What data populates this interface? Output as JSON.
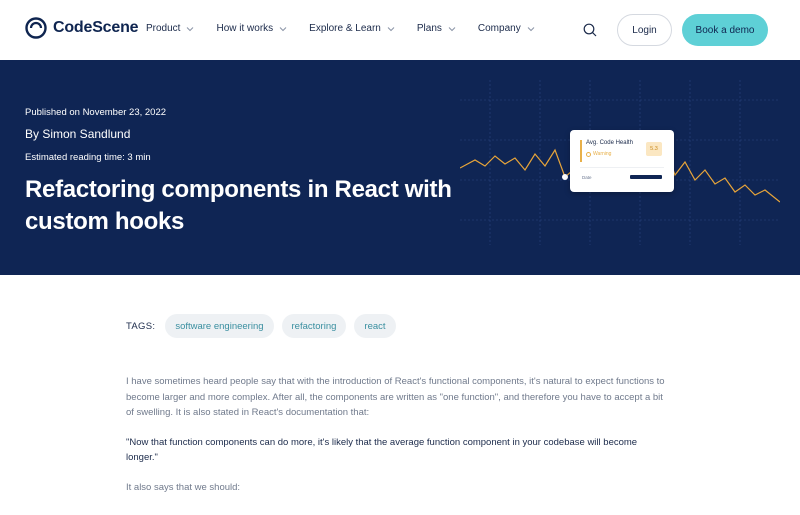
{
  "header": {
    "logo_text": "CodeScene",
    "menu": [
      {
        "label": "Product"
      },
      {
        "label": "How it works"
      },
      {
        "label": "Explore & Learn"
      },
      {
        "label": "Plans"
      },
      {
        "label": "Company"
      }
    ],
    "login_label": "Login",
    "demo_label": "Book a demo",
    "accent_color": "#5ed0d6"
  },
  "hero": {
    "published": "Published on November 23, 2022",
    "author": "By Simon Sandlund",
    "reading_time": "Estimated reading time: 3 min",
    "title": "Refactoring components in React with custom hooks",
    "background_color": "#0f2554",
    "card": {
      "title": "Avg. Code Health",
      "status": "Warning",
      "score": "5.3",
      "date_label": "Date"
    }
  },
  "tags": {
    "label": "TAGS:",
    "items": [
      "software engineering",
      "refactoring",
      "react"
    ]
  },
  "article": {
    "intro": "I have sometimes heard people say that with the introduction of React's functional components, it's natural to expect functions to become larger and more complex. After all, the components are written as \"one function\", and therefore you have to accept a bit of swelling. It is also stated in React's documentation that:",
    "quote": "\"Now that function components can do more, it's likely that the average function component in your codebase will become longer.\"",
    "followup": "It also says that we should:"
  }
}
